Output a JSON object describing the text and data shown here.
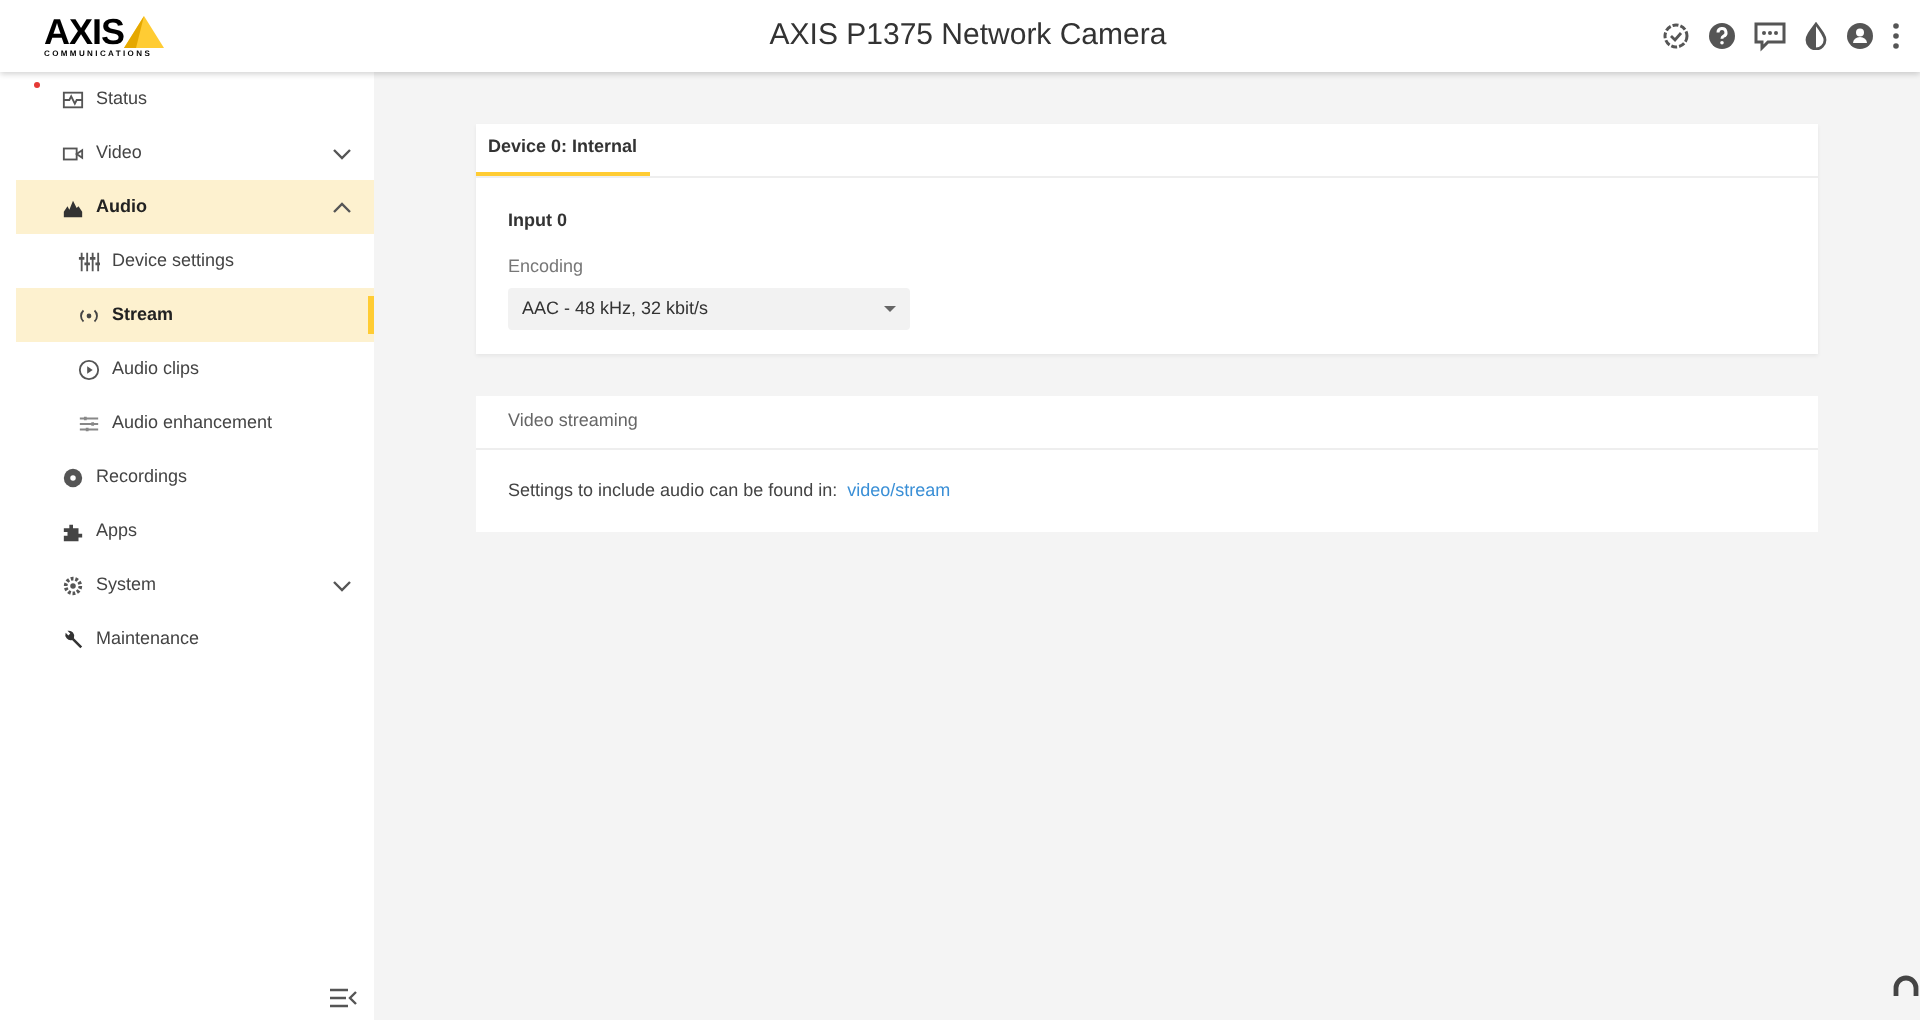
{
  "header": {
    "logo": {
      "wordmark": "AXIS",
      "tagline": "COMMUNICATIONS"
    },
    "title": "AXIS P1375 Network Camera"
  },
  "sidebar": {
    "items": [
      {
        "label": "Status",
        "kind": "top",
        "selected": false,
        "alert": true
      },
      {
        "label": "Video",
        "kind": "top",
        "selected": false,
        "expanded": false
      },
      {
        "label": "Audio",
        "kind": "top",
        "selected": true,
        "expanded": true
      },
      {
        "label": "Device settings",
        "kind": "sub",
        "selected": false
      },
      {
        "label": "Stream",
        "kind": "sub",
        "selected": true
      },
      {
        "label": "Audio clips",
        "kind": "sub",
        "selected": false
      },
      {
        "label": "Audio enhancement",
        "kind": "sub",
        "selected": false
      },
      {
        "label": "Recordings",
        "kind": "top",
        "selected": false
      },
      {
        "label": "Apps",
        "kind": "top",
        "selected": false
      },
      {
        "label": "System",
        "kind": "top",
        "selected": false,
        "expanded": false
      },
      {
        "label": "Maintenance",
        "kind": "top",
        "selected": false
      }
    ]
  },
  "device_card": {
    "tabs": [
      {
        "label": "Device 0: Internal",
        "selected": true
      }
    ],
    "input_title": "Input 0",
    "encoding": {
      "label": "Encoding",
      "value": "AAC - 48 kHz, 32 kbit/s"
    }
  },
  "streaming_card": {
    "title": "Video streaming",
    "text": "Settings to include audio can be found in:",
    "link": "video/stream"
  }
}
